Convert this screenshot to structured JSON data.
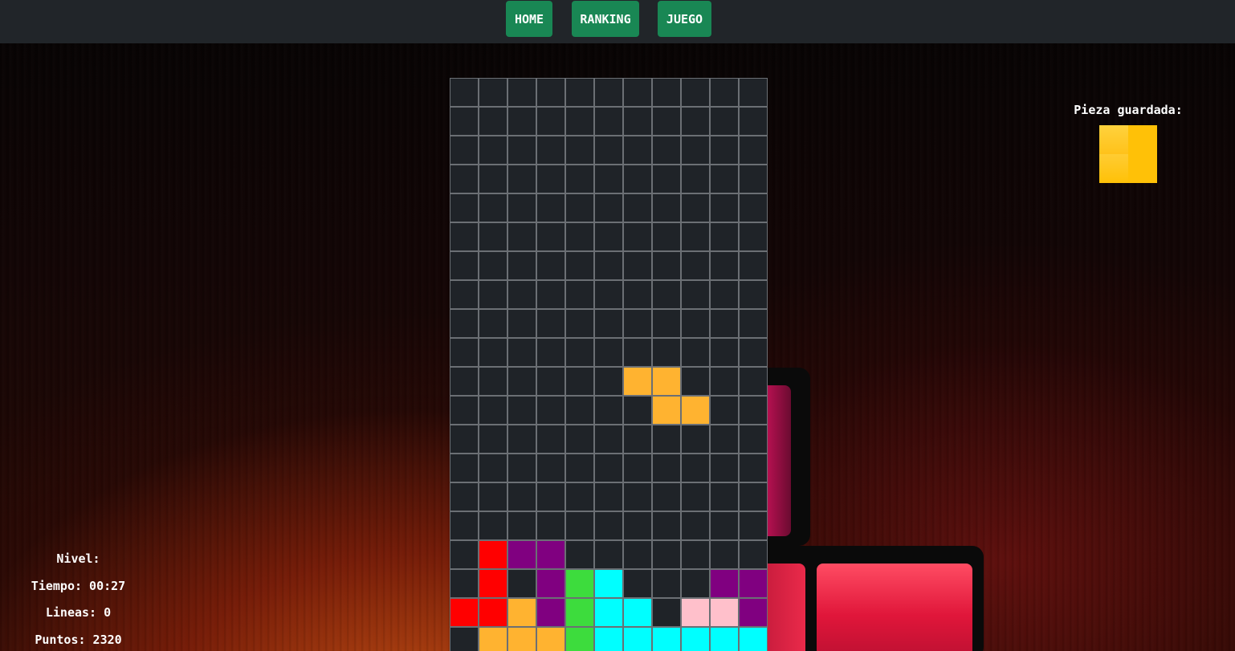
{
  "nav": {
    "home_label": "HOME",
    "ranking_label": "RANKING",
    "juego_label": "JUEGO"
  },
  "colors": {
    "nav_bg": "#212529",
    "button_bg": "#198754",
    "board_bg": "#1f2328",
    "grid_line": "#6b6f74",
    "O": "#ffc107",
    "Z": "#ffb330",
    "red": "#ff0000",
    "purple": "#800080",
    "green": "#3ddc3d",
    "cyan": "#00ffff",
    "pink": "#ffc0cb",
    "orange": "#ffb330"
  },
  "board": {
    "columns": 11,
    "rows": 20,
    "active_piece": {
      "type": "Z",
      "color": "orange",
      "cells": [
        [
          6,
          10
        ],
        [
          7,
          10
        ],
        [
          7,
          11
        ],
        [
          8,
          11
        ]
      ]
    },
    "locked": [
      [
        1,
        16,
        "red"
      ],
      [
        2,
        16,
        "purple"
      ],
      [
        3,
        16,
        "purple"
      ],
      [
        1,
        17,
        "red"
      ],
      [
        3,
        17,
        "purple"
      ],
      [
        4,
        17,
        "green"
      ],
      [
        5,
        17,
        "cyan"
      ],
      [
        9,
        17,
        "purple"
      ],
      [
        10,
        17,
        "purple"
      ],
      [
        0,
        18,
        "red"
      ],
      [
        1,
        18,
        "red"
      ],
      [
        2,
        18,
        "orange"
      ],
      [
        3,
        18,
        "purple"
      ],
      [
        4,
        18,
        "green"
      ],
      [
        5,
        18,
        "cyan"
      ],
      [
        6,
        18,
        "cyan"
      ],
      [
        8,
        18,
        "pink"
      ],
      [
        9,
        18,
        "pink"
      ],
      [
        10,
        18,
        "purple"
      ],
      [
        1,
        19,
        "orange"
      ],
      [
        2,
        19,
        "orange"
      ],
      [
        3,
        19,
        "orange"
      ],
      [
        4,
        19,
        "green"
      ],
      [
        5,
        19,
        "cyan"
      ],
      [
        6,
        19,
        "cyan"
      ],
      [
        7,
        19,
        "cyan"
      ],
      [
        8,
        19,
        "cyan"
      ],
      [
        9,
        19,
        "cyan"
      ],
      [
        10,
        19,
        "cyan"
      ]
    ]
  },
  "hold": {
    "title": "Pieza guardada:",
    "piece_type": "O",
    "color": "O"
  },
  "stats": {
    "nivel": "Nivel:",
    "tiempo": "Tiempo: 00:27",
    "lineas": "Lineas: 0",
    "puntos": "Puntos: 2320"
  }
}
